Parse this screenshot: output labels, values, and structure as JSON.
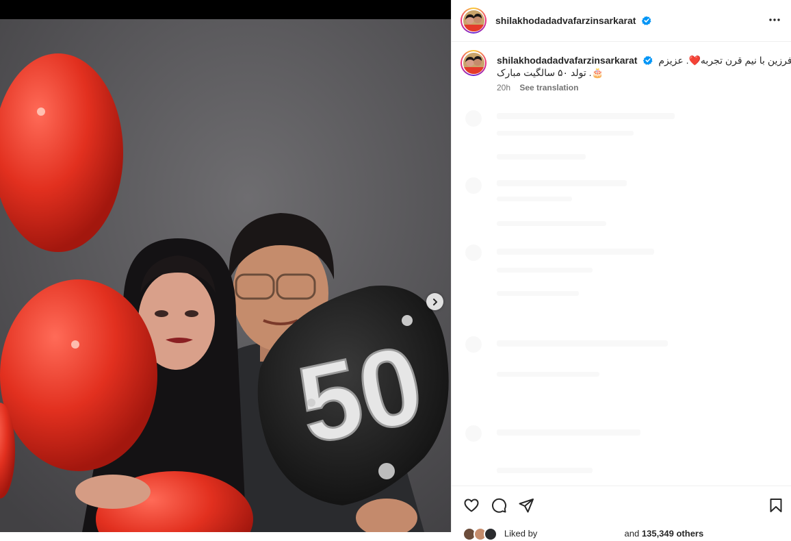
{
  "post": {
    "username": "shilakhodadadvafarzinsarkarat",
    "caption_line1": "فرزین با نیم قرن تجربه❤️. عزیزم",
    "caption_line2": "🎂. تولد ۵۰ سالگیت مبارک",
    "time": "20h",
    "see_translation": "See translation",
    "liked_prefix": "Liked by",
    "liked_middle": "and",
    "liked_count": "135,349 others",
    "balloon_number": "50"
  },
  "icons": {
    "verified": "verified-badge-icon",
    "more": "more-options-icon",
    "like": "heart-icon",
    "comment": "comment-icon",
    "share": "share-icon",
    "save": "bookmark-icon",
    "next": "chevron-right-icon"
  },
  "colors": {
    "verified_blue": "#0095f6",
    "balloon_red": "#e53a2a",
    "wall_gray": "#5e5d5f",
    "text": "#262626",
    "muted": "#737373"
  }
}
